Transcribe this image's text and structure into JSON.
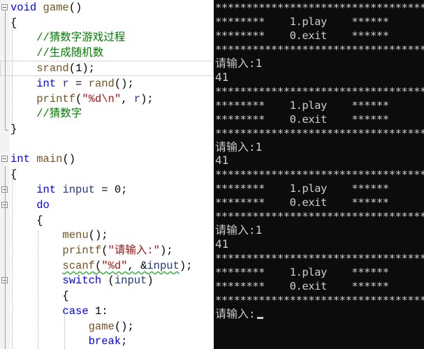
{
  "editor": {
    "lines": [
      {
        "tokens": [
          {
            "t": "void",
            "c": "kw"
          },
          {
            "t": " "
          },
          {
            "t": "game",
            "c": "fn"
          },
          {
            "t": "()"
          }
        ]
      },
      {
        "tokens": [
          {
            "t": "{"
          }
        ]
      },
      {
        "tokens": [
          {
            "t": "    //猜数字游戏过程",
            "c": "cm"
          }
        ]
      },
      {
        "tokens": [
          {
            "t": "    //生成随机数",
            "c": "cm"
          }
        ]
      },
      {
        "tokens": [
          {
            "t": "    "
          },
          {
            "t": "srand",
            "c": "fn"
          },
          {
            "t": "("
          },
          {
            "t": "1",
            "c": "nm"
          },
          {
            "t": ");"
          }
        ]
      },
      {
        "tokens": [
          {
            "t": "    "
          },
          {
            "t": "int",
            "c": "kw"
          },
          {
            "t": " "
          },
          {
            "t": "r",
            "c": "vr"
          },
          {
            "t": " = "
          },
          {
            "t": "rand",
            "c": "fn"
          },
          {
            "t": "();"
          }
        ]
      },
      {
        "tokens": [
          {
            "t": "    "
          },
          {
            "t": "printf",
            "c": "fn"
          },
          {
            "t": "("
          },
          {
            "t": "\"",
            "c": "st"
          },
          {
            "t": "%d\\n",
            "c": "fm"
          },
          {
            "t": "\"",
            "c": "st"
          },
          {
            "t": ", "
          },
          {
            "t": "r",
            "c": "vr"
          },
          {
            "t": ");"
          }
        ]
      },
      {
        "tokens": [
          {
            "t": "    //猜数字",
            "c": "cm"
          }
        ]
      },
      {
        "tokens": [
          {
            "t": "}"
          }
        ]
      },
      {
        "tokens": []
      },
      {
        "tokens": [
          {
            "t": "int",
            "c": "kw"
          },
          {
            "t": " "
          },
          {
            "t": "main",
            "c": "fn"
          },
          {
            "t": "()"
          }
        ]
      },
      {
        "tokens": [
          {
            "t": "{"
          }
        ]
      },
      {
        "tokens": [
          {
            "t": "    "
          },
          {
            "t": "int",
            "c": "kw"
          },
          {
            "t": " "
          },
          {
            "t": "input",
            "c": "vr"
          },
          {
            "t": " = "
          },
          {
            "t": "0",
            "c": "nm"
          },
          {
            "t": ";"
          }
        ]
      },
      {
        "tokens": [
          {
            "t": "    "
          },
          {
            "t": "do",
            "c": "kw"
          }
        ]
      },
      {
        "tokens": [
          {
            "t": "    {"
          }
        ]
      },
      {
        "tokens": [
          {
            "t": "        "
          },
          {
            "t": "menu",
            "c": "fn"
          },
          {
            "t": "();"
          }
        ]
      },
      {
        "tokens": [
          {
            "t": "        "
          },
          {
            "t": "printf",
            "c": "fn"
          },
          {
            "t": "("
          },
          {
            "t": "\"请输入:\"",
            "c": "st"
          },
          {
            "t": ");"
          }
        ]
      },
      {
        "tokens": [
          {
            "t": "        "
          },
          {
            "t": "scanf",
            "c": "fn sq"
          },
          {
            "t": "(",
            "c": "sq"
          },
          {
            "t": "\"%d\"",
            "c": "st sq"
          },
          {
            "t": ", &",
            "c": "sq"
          },
          {
            "t": "input",
            "c": "vr sq"
          },
          {
            "t": ");"
          }
        ]
      },
      {
        "tokens": [
          {
            "t": "        "
          },
          {
            "t": "switch",
            "c": "kw"
          },
          {
            "t": " ("
          },
          {
            "t": "input",
            "c": "vr"
          },
          {
            "t": ")"
          }
        ]
      },
      {
        "tokens": [
          {
            "t": "        {"
          }
        ]
      },
      {
        "tokens": [
          {
            "t": "        "
          },
          {
            "t": "case",
            "c": "kw"
          },
          {
            "t": " "
          },
          {
            "t": "1",
            "c": "nm"
          },
          {
            "t": ":"
          }
        ]
      },
      {
        "tokens": [
          {
            "t": "            "
          },
          {
            "t": "game",
            "c": "fn"
          },
          {
            "t": "();"
          }
        ]
      },
      {
        "tokens": [
          {
            "t": "            "
          },
          {
            "t": "break",
            "c": "kw"
          },
          {
            "t": ";"
          }
        ]
      }
    ]
  },
  "console": {
    "stars_row": "****************************************",
    "menu_play": "********    1.play    ******",
    "menu_exit": "********    0.exit    ******",
    "prompt": "请输入:",
    "entered_value": "1",
    "output_value": "41"
  },
  "colors": {
    "console_bg": "#0c0c0c",
    "console_text": "#cccccc",
    "keyword": "#0000ff",
    "comment": "#008000"
  }
}
